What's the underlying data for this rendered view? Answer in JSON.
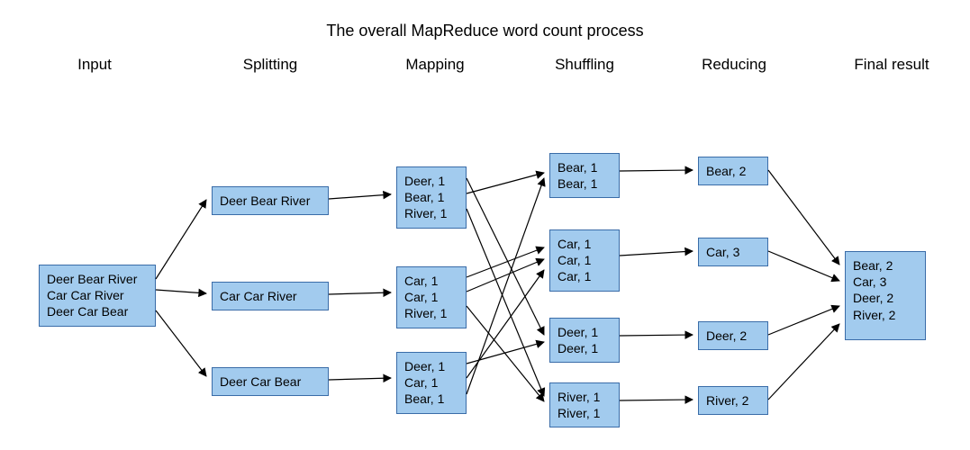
{
  "title": "The overall MapReduce word count process",
  "stages": {
    "input": "Input",
    "splitting": "Splitting",
    "mapping": "Mapping",
    "shuffling": "Shuffling",
    "reducing": "Reducing",
    "final": "Final result"
  },
  "nodes": {
    "input0": "Deer Bear River\nCar Car River\nDeer Car Bear",
    "split0": "Deer Bear River",
    "split1": "Car Car River",
    "split2": "Deer Car Bear",
    "map0": "Deer, 1\nBear, 1\nRiver, 1",
    "map1": "Car, 1\nCar, 1\nRiver, 1",
    "map2": "Deer, 1\nCar, 1\nBear, 1",
    "shuf0": "Bear, 1\nBear, 1",
    "shuf1": "Car, 1\nCar, 1\nCar, 1",
    "shuf2": "Deer, 1\nDeer, 1",
    "shuf3": "River, 1\nRiver, 1",
    "red0": "Bear, 2",
    "red1": "Car, 3",
    "red2": "Deer, 2",
    "red3": "River, 2",
    "final0": "Bear, 2\nCar, 3\nDeer, 2\nRiver, 2"
  }
}
